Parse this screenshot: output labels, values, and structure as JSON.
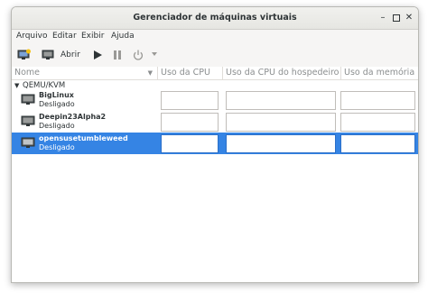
{
  "window": {
    "title": "Gerenciador de máquinas virtuais"
  },
  "menubar": {
    "items": [
      "Arquivo",
      "Editar",
      "Exibir",
      "Ajuda"
    ]
  },
  "toolbar": {
    "open_label": "Abrir"
  },
  "columns": {
    "name": "Nome",
    "cpu": "Uso da CPU",
    "host_cpu": "Uso da CPU do hospedeiro",
    "memory": "Uso da memória"
  },
  "group": {
    "label": "QEMU/KVM"
  },
  "vms": [
    {
      "name": "BigLinux",
      "status": "Desligado",
      "selected": false
    },
    {
      "name": "Deepin23Alpha2",
      "status": "Desligado",
      "selected": false
    },
    {
      "name": "opensusetumbleweed",
      "status": "Desligado",
      "selected": true
    }
  ],
  "colors": {
    "accent": "#3584e4"
  }
}
